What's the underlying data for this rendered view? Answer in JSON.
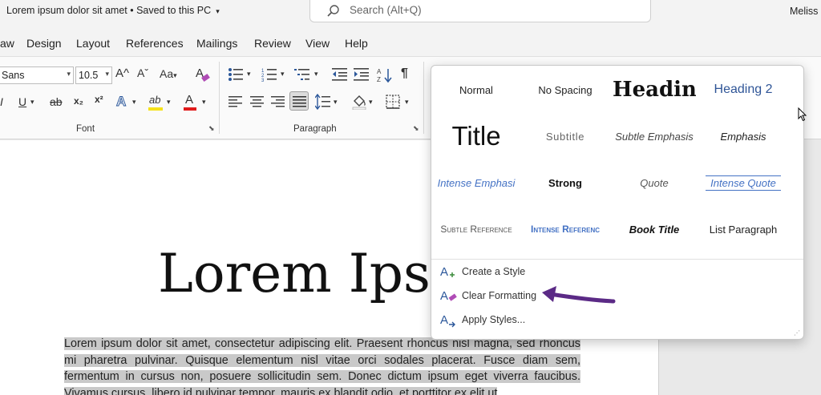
{
  "titlebar": {
    "doc_title": "Lorem ipsum dolor sit amet • Saved to this PC",
    "doc_title_caret": "▾",
    "search_placeholder": "Search (Alt+Q)",
    "user_name": "Meliss"
  },
  "menu": {
    "tabs": [
      "aw",
      "Design",
      "Layout",
      "References",
      "Mailings",
      "Review",
      "View",
      "Help"
    ]
  },
  "ribbon": {
    "font_name": "Sans",
    "font_size": "10.5",
    "grow_font": "A^",
    "shrink_font": "Aˇ",
    "change_case": "Aa",
    "italic": "I",
    "underline": "U",
    "strikethrough": "ab",
    "subscript": "x₂",
    "superscript": "x²",
    "text_effects": "A",
    "highlight": "ab",
    "font_color": "A",
    "font_group_label": "Font",
    "paragraph_group_label": "Paragraph",
    "show_marks": "¶",
    "chev": "▾"
  },
  "gallery": {
    "styles": [
      {
        "label": "Normal"
      },
      {
        "label": "No Spacing"
      },
      {
        "label": "Headin"
      },
      {
        "label": "Heading 2"
      },
      {
        "label": "Title"
      },
      {
        "label": "Subtitle"
      },
      {
        "label": "Subtle Emphasis"
      },
      {
        "label": "Emphasis"
      },
      {
        "label": "Intense Emphasi"
      },
      {
        "label": "Strong"
      },
      {
        "label": "Quote"
      },
      {
        "label": "Intense Quote"
      },
      {
        "label": "Subtle Reference"
      },
      {
        "label": "Intense Referenc"
      },
      {
        "label": "Book Title"
      },
      {
        "label": "List Paragraph"
      }
    ],
    "commands": {
      "create_style": "Create a Style",
      "clear_formatting": "Clear Formatting",
      "apply_styles": "Apply Styles..."
    },
    "grip": "⋰"
  },
  "document": {
    "heading": "Lorem Ipsu",
    "body": "Lorem ipsum dolor sit amet, consectetur adipiscing elit. Praesent rhoncus nisl magna, sed rhoncus mi pharetra pulvinar. Quisque elementum nisl vitae orci sodales placerat. Fusce diam sem, fermentum in cursus non, posuere sollicitudin sem. Donec dictum ipsum eget viverra faucibus. Vivamus cursus, libero id pulvinar tempor, mauris ex blandit odio, et porttitor ex elit ut"
  },
  "colors": {
    "accent_blue": "#2b579a",
    "heading2_blue": "#2f5597",
    "intense_blue": "#4472c4",
    "annotation_purple": "#5b2a86"
  },
  "icons": [
    "search-icon",
    "shading-icon",
    "borders-icon",
    "bullets-icon",
    "numbering-icon",
    "multilevel-list-icon",
    "decrease-indent-icon",
    "increase-indent-icon",
    "sort-icon",
    "align-left-icon",
    "center-icon",
    "align-right-icon",
    "justify-icon",
    "line-spacing-icon",
    "create-style-icon",
    "clear-formatting-icon",
    "apply-styles-icon",
    "mouse-cursor-icon",
    "annotation-arrow-icon"
  ]
}
